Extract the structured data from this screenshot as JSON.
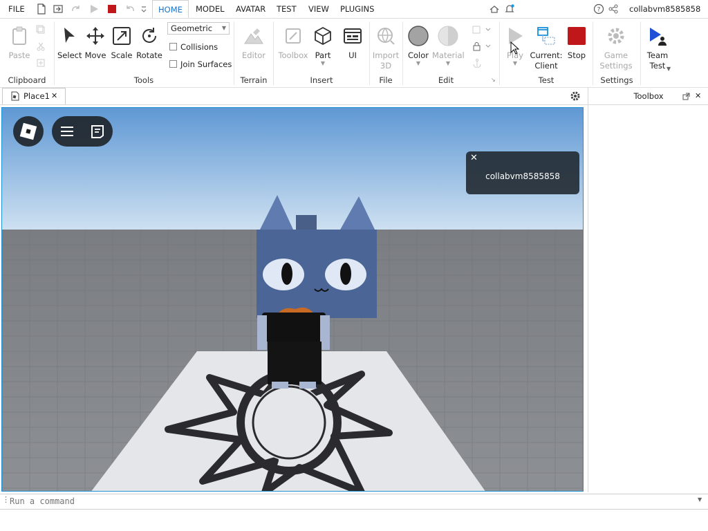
{
  "menu": {
    "file": "FILE",
    "tabs": [
      "HOME",
      "MODEL",
      "AVATAR",
      "TEST",
      "VIEW",
      "PLUGINS"
    ],
    "active_tab": "HOME",
    "username": "collabvm8585858"
  },
  "ribbon": {
    "clipboard": {
      "paste": "Paste",
      "label": "Clipboard"
    },
    "tools": {
      "select": "Select",
      "move": "Move",
      "scale": "Scale",
      "rotate": "Rotate",
      "mode_value": "Geometric",
      "collisions": "Collisions",
      "join_surfaces": "Join Surfaces",
      "label": "Tools"
    },
    "terrain": {
      "editor": "Editor",
      "label": "Terrain"
    },
    "insert": {
      "toolbox": "Toolbox",
      "part": "Part",
      "ui": "UI",
      "label": "Insert"
    },
    "file": {
      "import_line1": "Import",
      "import_line2": "3D",
      "label": "File"
    },
    "edit": {
      "color": "Color",
      "material": "Material",
      "label": "Edit"
    },
    "test": {
      "play": "Play",
      "current_line1": "Current:",
      "current_line2": "Client",
      "stop": "Stop",
      "label": "Test"
    },
    "settings": {
      "game_line1": "Game",
      "game_line2": "Settings",
      "label": "Settings"
    },
    "team": {
      "line1": "Team",
      "line2": "Test"
    }
  },
  "document_tab": {
    "title": "Place1"
  },
  "toolbox_panel": {
    "title": "Toolbox"
  },
  "viewport": {
    "notification_text": "collabvm8585858"
  },
  "command_bar": {
    "placeholder": "Run a command"
  },
  "colors": {
    "accent": "#1a73c8",
    "stop_red": "#c0171b",
    "viewport_border": "#1f8fd6"
  }
}
